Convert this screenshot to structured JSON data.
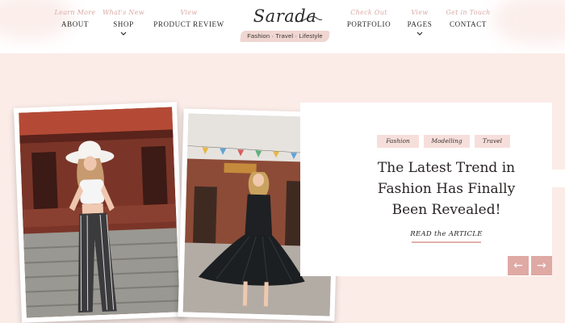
{
  "nav_left": [
    {
      "sub": "Learn More",
      "label": "ABOUT",
      "has_dropdown": false
    },
    {
      "sub": "What's New",
      "label": "SHOP",
      "has_dropdown": true
    },
    {
      "sub": "View",
      "label": "PRODUCT REVIEW",
      "has_dropdown": false
    }
  ],
  "nav_right": [
    {
      "sub": "Check Out",
      "label": "PORTFOLIO",
      "has_dropdown": false
    },
    {
      "sub": "View",
      "label": "PAGES",
      "has_dropdown": true
    },
    {
      "sub": "Get in Touch",
      "label": "CONTACT",
      "has_dropdown": false
    }
  ],
  "logo": {
    "name": "Sarada",
    "tagline": "Fashion · Travel · Lifestyle"
  },
  "hero": {
    "tags": [
      "Fashion",
      "Modelling",
      "Travel"
    ],
    "headline_lines": [
      "The Latest Trend in",
      "Fashion Has Finally",
      "Been Revealed!"
    ],
    "cta": "READ the ARTICLE",
    "prev_icon": "arrow-left-icon",
    "next_icon": "arrow-right-icon",
    "prev_glyph": "←",
    "next_glyph": "→"
  },
  "colors": {
    "page_bg": "#fbece8",
    "accent": "#dfa9a4",
    "tag_bg": "#f6dfdb",
    "subnav_text": "#d9a9a5",
    "text": "#2a2424"
  }
}
